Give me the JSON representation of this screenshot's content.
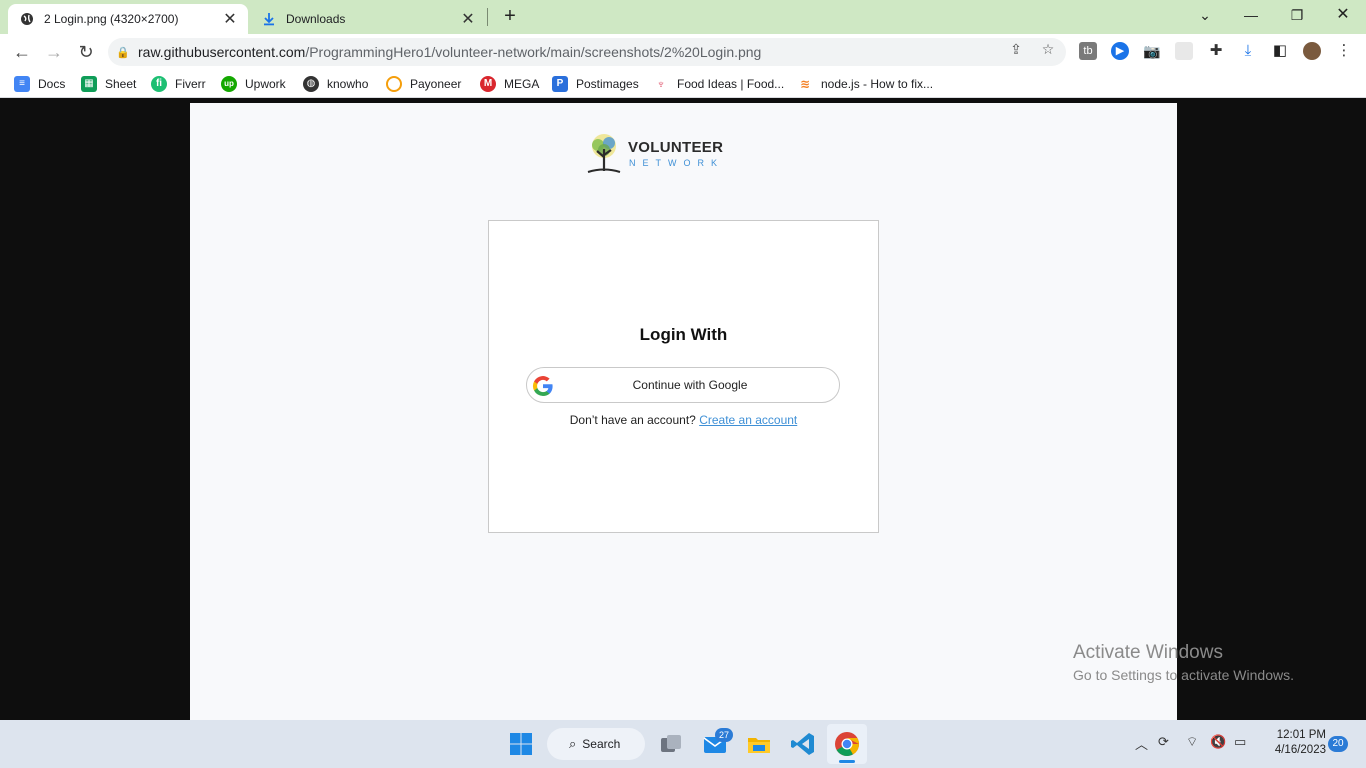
{
  "browser": {
    "tabs": [
      {
        "title": "2 Login.png (4320×2700)",
        "active": true
      },
      {
        "title": "Downloads",
        "active": false
      }
    ],
    "url_host": "raw.githubusercontent.com",
    "url_path": "/ProgrammingHero1/volunteer-network/main/screenshots/2%20Login.png",
    "bookmarks": [
      "Docs",
      "Sheet",
      "Fiverr",
      "Upwork",
      "knowho",
      "Payoneer",
      "MEGA",
      "Postimages",
      "Food Ideas | Food...",
      "node.js - How to fix..."
    ]
  },
  "page": {
    "brand": {
      "main": "VOLUNTEER",
      "sub": "NETWORK"
    },
    "login": {
      "heading": "Login With",
      "google_button": "Continue with Google",
      "no_account": "Don’t have an account?",
      "create_link": "Create an account"
    }
  },
  "watermark": {
    "title": "Activate Windows",
    "subtitle": "Go to Settings to activate Windows."
  },
  "taskbar": {
    "search_label": "Search",
    "mail_badge": "27",
    "time": "12:01 PM",
    "date": "4/16/2023",
    "notifications": "20"
  },
  "colors": {
    "tabbar": "#cfe8c4",
    "link": "#3f90d6",
    "taskbar": "#dde4ee"
  }
}
